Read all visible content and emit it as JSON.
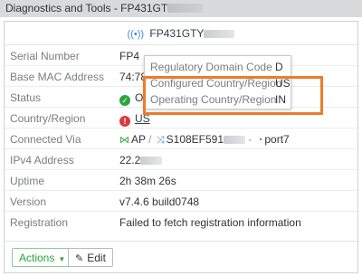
{
  "header": {
    "title": "Diagnostics and Tools - FP431GT"
  },
  "device": {
    "name": "FP431GTY",
    "signal_icon": "wireless-signal-icon"
  },
  "rows": [
    {
      "label": "Serial Number",
      "value": "FP4"
    },
    {
      "label": "Base MAC Address",
      "value": "74:78"
    },
    {
      "label": "Status",
      "value": "O"
    },
    {
      "label": "Country/Region",
      "value": "US"
    },
    {
      "label": "Connected Via",
      "ap": "AP",
      "switch": "S108EF591",
      "port": "port7"
    },
    {
      "label": "IPv4 Address",
      "value": "22.2"
    },
    {
      "label": "Uptime",
      "value": "2h 38m 26s"
    },
    {
      "label": "Version",
      "value": "v7.4.6 build0748"
    },
    {
      "label": "Registration",
      "value": "Failed to fetch registration information"
    }
  ],
  "tooltip": {
    "items": [
      {
        "label": "Regulatory Domain Code",
        "value": "D"
      },
      {
        "label": "Configured Country/Region",
        "value": "US"
      },
      {
        "label": "Operating Country/Region",
        "value": "IN"
      }
    ]
  },
  "footer": {
    "actions_label": "Actions",
    "edit_label": "Edit"
  },
  "colors": {
    "accent_green": "#2aa53c",
    "highlight_orange": "#f07a2a",
    "error_red": "#d93a3a",
    "link_blue": "#3d8bd8"
  }
}
